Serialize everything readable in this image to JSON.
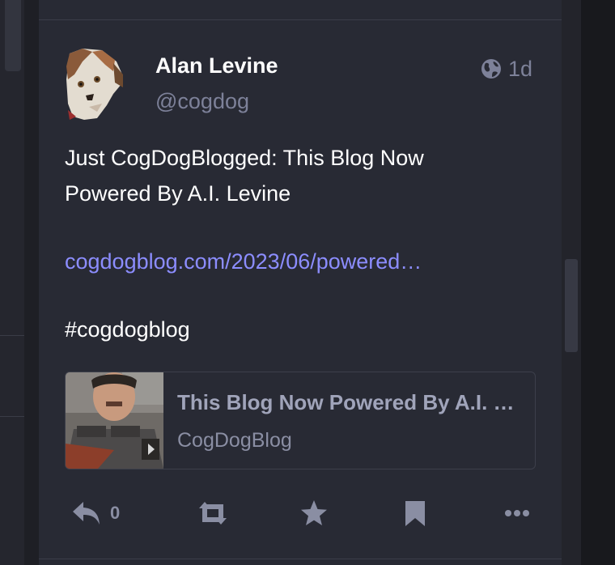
{
  "status": {
    "author": {
      "display_name": "Alan Levine",
      "handle": "@cogdog",
      "avatar_icon": "dog-avatar"
    },
    "visibility_icon": "globe-icon",
    "timestamp": "1d",
    "content": {
      "line1": "Just CogDogBlogged: This Blog Now",
      "line2": "Powered By A.I. Levine",
      "link_text": "cogdogblog.com/2023/06/powered…",
      "hashtag": "#cogdogblog"
    },
    "card": {
      "title": "This Blog Now Powered By A.I. …",
      "site": "CogDogBlog"
    },
    "actions": {
      "reply_count": "0"
    }
  },
  "colors": {
    "background": "#282a34",
    "text": "#ffffff",
    "secondary_text": "#7d8199",
    "link": "#8c8dff",
    "icon": "#8a8ea3"
  }
}
